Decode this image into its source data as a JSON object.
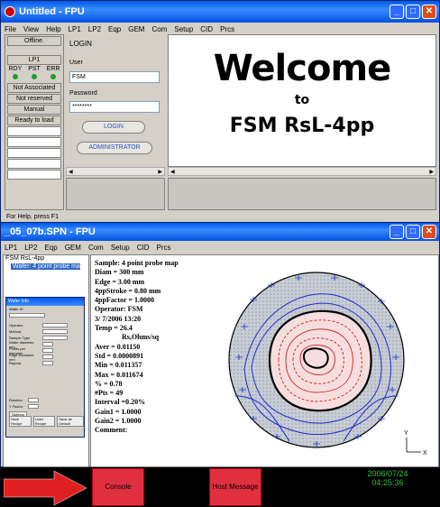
{
  "window1": {
    "title": "Untitled - FPU",
    "menu": [
      "File",
      "View",
      "Help",
      "LP1",
      "LP2",
      "Eqp",
      "GEM",
      "Com",
      "Setup",
      "CID",
      "Prcs"
    ],
    "status": {
      "offline": "Offline.",
      "lp_label": "LP1",
      "led_labels": [
        "RDY",
        "PST",
        "ERR"
      ],
      "items": [
        "Not Associated",
        "Not reserved",
        "Manual",
        "Ready to load"
      ]
    },
    "login": {
      "heading": "LOGIN",
      "user_label": "User",
      "user_value": "FSM",
      "password_label": "Password",
      "password_value": "********",
      "login_button": "LOGIN",
      "admin_button": "ADMINISTRATOR"
    },
    "welcome": {
      "line1": "Welcome",
      "line2": "to",
      "line3": "FSM RsL-4pp"
    },
    "statusbar": "For Help, press F1"
  },
  "window2": {
    "title": "_05_07b.SPN - FPU",
    "menu": [
      "LP1",
      "LP2",
      "Eqp",
      "GEM",
      "Com",
      "Setup",
      "CID",
      "Prcs"
    ],
    "tree": {
      "root": "FSM RsL-4pp",
      "child": "Wafer: 4 point probe ma"
    },
    "wafer_info": {
      "title": "Wafer Info",
      "rows": [
        "Wafer ID",
        "Operator",
        "Method",
        "Sample Type",
        "Wafer diameter, mm",
        "Points per diameter",
        "Edge exclusion, mm",
        "Repeat",
        "Rotation",
        "Y Factor"
      ],
      "buttons": [
        "Options",
        "Save Recipe",
        "Load Recipe",
        "Save as Default"
      ]
    },
    "stats": [
      "Sample: 4 point probe map",
      "Diam = 300 mm",
      "Edge = 3.00 mm",
      "4ppStroke = 0.80 mm",
      "4ppFactor = 1.0000",
      "Operator: FSM",
      "3/ 7/2006 13:20",
      "Temp = 26.4",
      "Rs,Ohms/sq",
      "Aver = 0.01150",
      "Std = 0.0000891",
      "Min = 0.011357",
      "Max = 0.011674",
      "% = 0.78",
      "#Pts = 49",
      "Interval =0.20%",
      "Gain1 = 1.0000",
      "Gain2 = 1.0000",
      "Comment:"
    ],
    "axis": {
      "y": "Y",
      "x": "X"
    }
  },
  "bottom": {
    "console": "Console",
    "host_message": "Host Message",
    "date": "2006/07/24",
    "time": "04:25:36",
    "colors": {
      "arrow": "#e02020",
      "button": "#e03040",
      "clock": "#30c040"
    }
  }
}
